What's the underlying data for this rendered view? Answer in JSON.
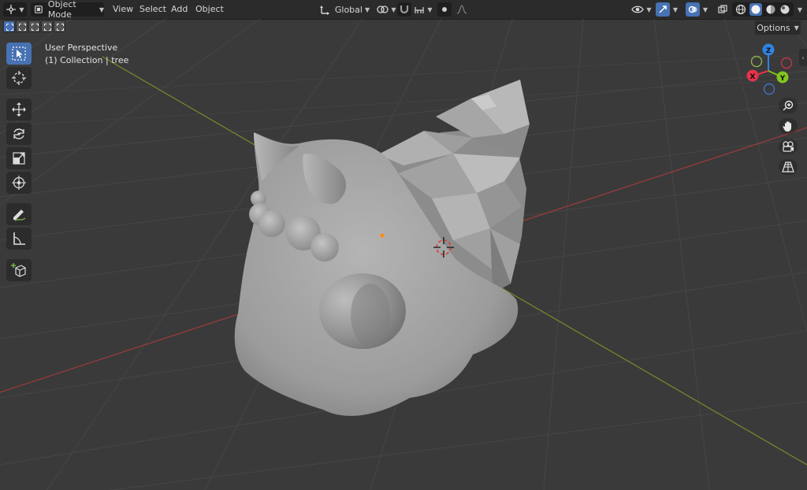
{
  "header": {
    "editor_type_icon": "editor-type-3d-viewport-icon",
    "mode": {
      "label": "Object Mode",
      "icon": "object-mode-icon"
    },
    "menus": [
      "View",
      "Select",
      "Add",
      "Object"
    ],
    "transform_orientation": {
      "label": "Global"
    },
    "pivot_icon": "pivot-icon",
    "snap_icon": "magnet-icon",
    "snap_target_icon": "snap-increment-icon",
    "proportional_icon": "proportional-editing-icon",
    "falloff_icon": "falloff-curve-icon",
    "visibility_icon": "eye-icon",
    "gizmo_icon": "gizmo-icon",
    "overlay_icon": "overlays-icon",
    "xray_icon": "xray-icon",
    "shading_modes": [
      "wireframe",
      "solid",
      "material-preview",
      "rendered"
    ],
    "active_shading": "solid"
  },
  "subbar": {
    "select_modes": [
      "new",
      "extend",
      "subtract",
      "invert",
      "intersect"
    ],
    "active_select_mode": "new",
    "options_label": "Options"
  },
  "toolbar": {
    "tools": [
      "select-box",
      "cursor",
      "move",
      "rotate",
      "scale",
      "transform",
      "annotate",
      "measure",
      "add-cube"
    ],
    "active_tool": "select-box"
  },
  "view_info": {
    "perspective": "User Perspective",
    "collection": "(1) Collection",
    "separator": "|",
    "object": "tree"
  },
  "gizmo": {
    "x_label": "X",
    "y_label": "Y",
    "z_label": "Z",
    "x_color": "#e2354b",
    "y_color": "#83c41f",
    "z_color": "#2f84e3"
  },
  "colors": {
    "accent": "#4772b3",
    "grid_background": "#3a3a3a",
    "x_axis": "#9a3a3a",
    "y_axis": "#7b8a2c"
  }
}
